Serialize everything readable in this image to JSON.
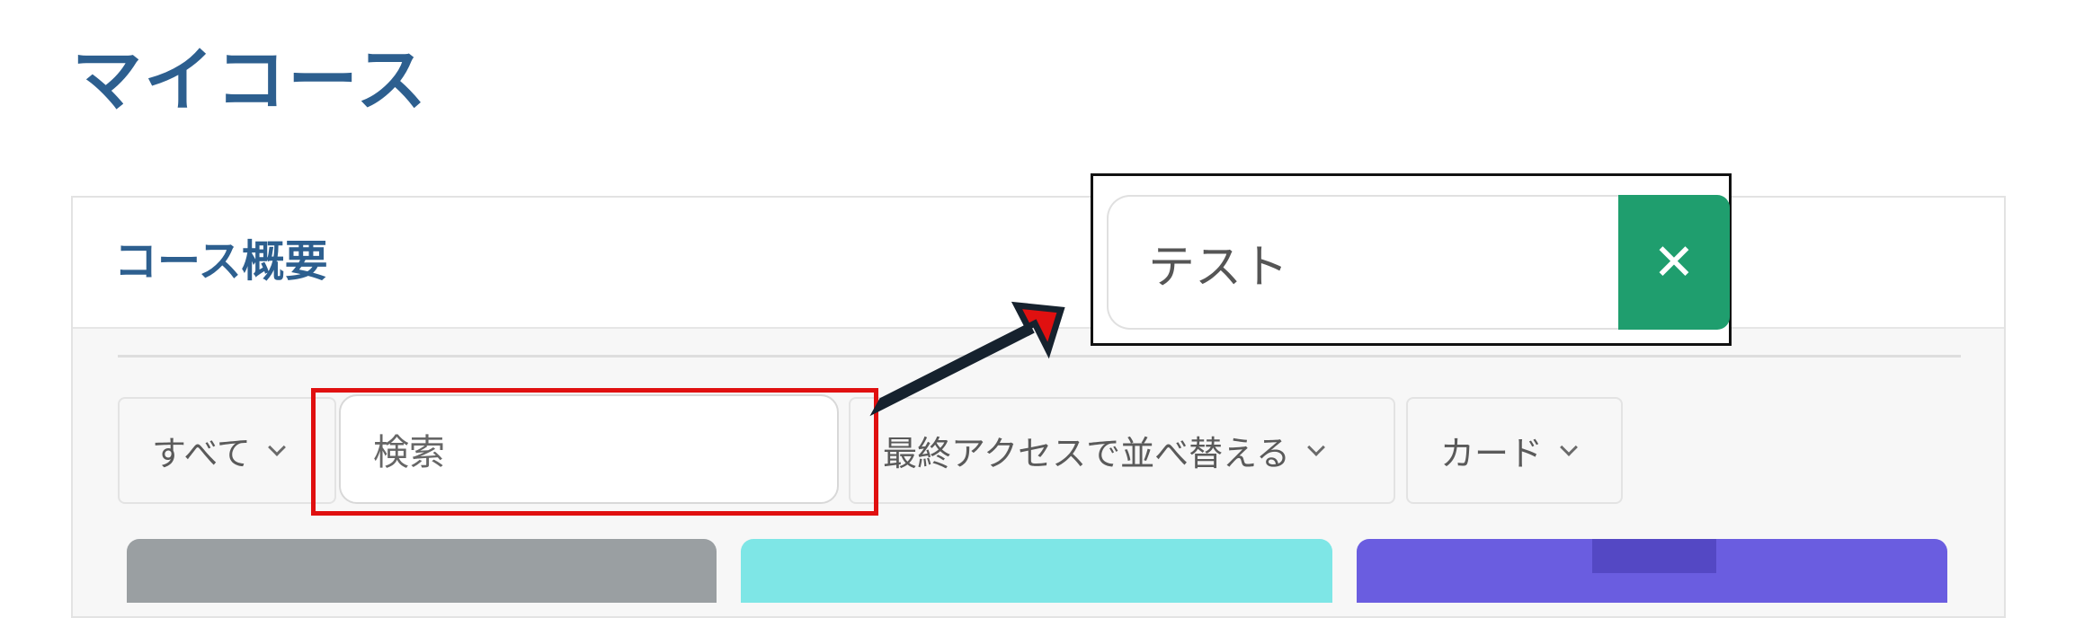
{
  "page": {
    "title": "マイコース"
  },
  "overview": {
    "title": "コース概要",
    "filters": {
      "grouping_label": "すべて",
      "search_placeholder": "検索",
      "sort_label": "最終アクセスで並べ替える",
      "view_label": "カード"
    }
  },
  "callout": {
    "search_value": "テスト",
    "clear_symbol": "✕"
  },
  "colors": {
    "title": "#2d5f8f",
    "highlight": "#e01010",
    "clear_button": "#1f9e6e",
    "thumb_gray": "#9a9fa2",
    "thumb_teal": "#7ee6e6",
    "thumb_purple": "#6a5de0"
  },
  "icons": {
    "dropdown": "chevron-down-icon",
    "clear": "close-icon",
    "annotation": "arrow-icon"
  }
}
